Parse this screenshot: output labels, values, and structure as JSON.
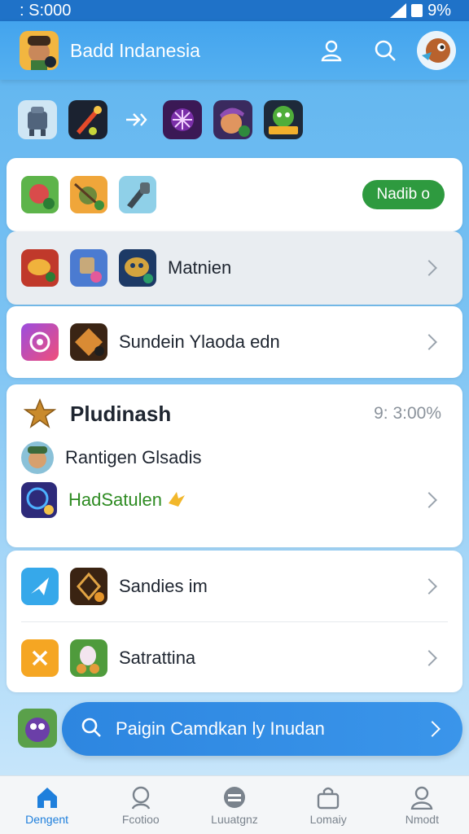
{
  "status": {
    "time": ": S:000",
    "battery": "9%"
  },
  "appbar": {
    "title": "Badd Indanesia"
  },
  "cards": {
    "first": {
      "button_label": "Nadib o"
    },
    "matnien": {
      "label": "Matnien"
    },
    "sundein": {
      "label": "Sundein Ylaoda edn"
    },
    "pludinash": {
      "title": "Pludinash",
      "value": "9: 3:00%",
      "sub1": "Rantigen Glsadis",
      "sub2": "HadSatulen"
    },
    "sandies": {
      "label": "Sandies im"
    },
    "satrattina": {
      "label": "Satrattina"
    }
  },
  "search": {
    "label": "Paigin Camdkan ly Inudan"
  },
  "nav": {
    "items": [
      {
        "label": "Dengent",
        "icon": "home-icon"
      },
      {
        "label": "Fcotioo",
        "icon": "user-search-icon"
      },
      {
        "label": "Luuatgnz",
        "icon": "menu-circle-icon"
      },
      {
        "label": "Lomaiy",
        "icon": "bag-icon"
      },
      {
        "label": "Nmodt",
        "icon": "profile-icon"
      }
    ]
  },
  "colors": {
    "accent": "#1e7fdc",
    "green": "#2e9a3f",
    "statusbar": "#1f72c8"
  }
}
